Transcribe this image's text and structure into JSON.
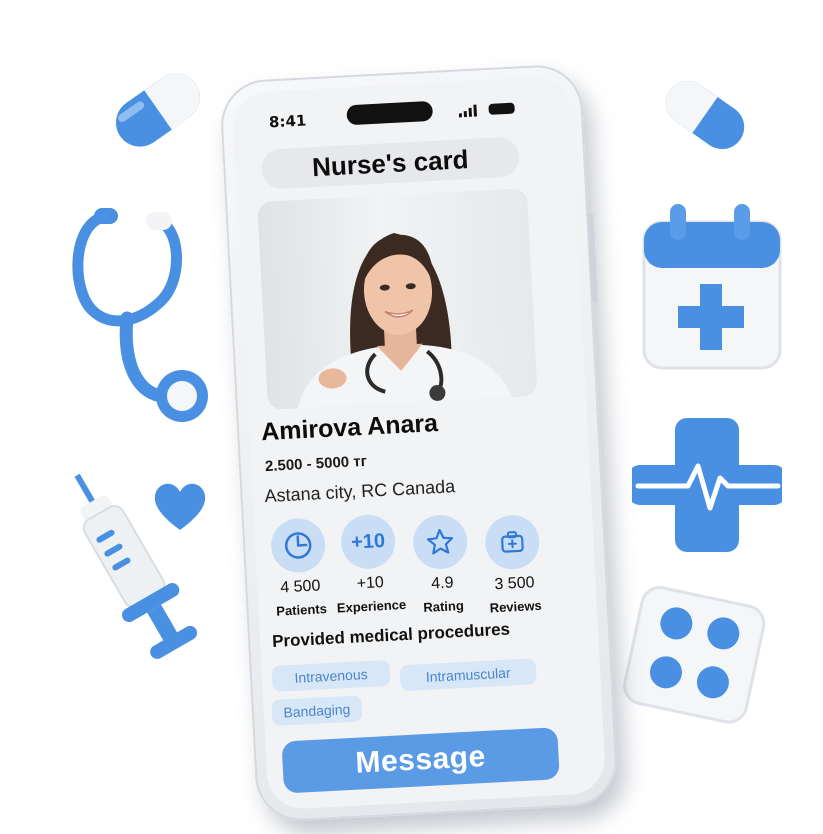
{
  "status_bar": {
    "time": "8:41"
  },
  "card": {
    "title": "Nurse's card",
    "name": "Amirova Anara",
    "price": "2.500 - 5000 тг",
    "location": "Astana city, RC Canada"
  },
  "stats": [
    {
      "icon": "clock-icon",
      "icon_text": "",
      "value": "4 500",
      "label": "Patients"
    },
    {
      "icon": "plus-ten-icon",
      "icon_text": "+10",
      "value": "+10",
      "label": "Experience"
    },
    {
      "icon": "star-icon",
      "icon_text": "",
      "value": "4.9",
      "label": "Rating"
    },
    {
      "icon": "medical-kit-icon",
      "icon_text": "",
      "value": "3 500",
      "label": "Reviews"
    }
  ],
  "procedures": {
    "heading": "Provided medical procedures",
    "items": [
      "Intravenous",
      "Intramuscular",
      "Bandaging"
    ]
  },
  "message_button": "Message",
  "decorations": [
    "pill-icon",
    "pill-icon",
    "stethoscope-icon",
    "calendar-plus-icon",
    "heart-icon",
    "heartbeat-cross-icon",
    "syringe-icon",
    "pill-blister-icon"
  ],
  "colors": {
    "accent": "#5b9be6",
    "icon_blue": "#4a90e2",
    "chip_bg": "#d7e7f8",
    "chip_text": "#4a86c8"
  }
}
